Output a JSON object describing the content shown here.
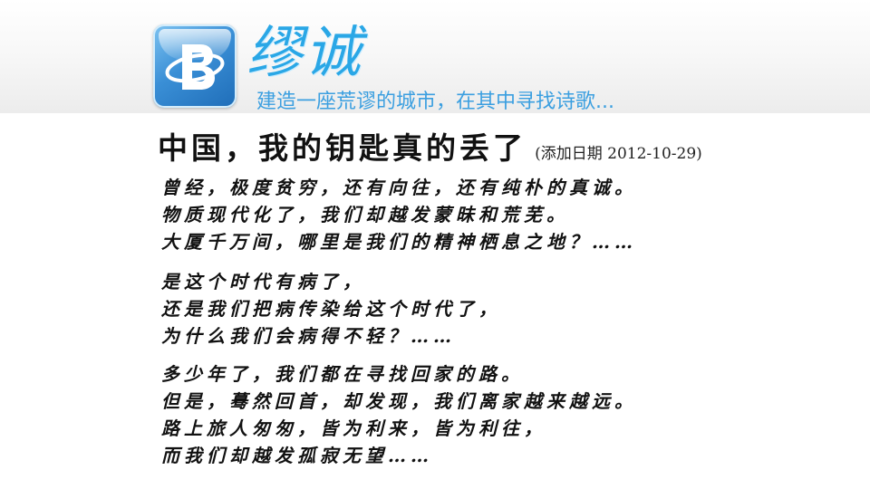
{
  "header": {
    "site_name": "缪诚",
    "tagline": "建造一座荒谬的城市，在其中寻找诗歌..."
  },
  "article": {
    "title": "中国，我的钥匙真的丢了",
    "date_note": "(添加日期 2012-10-29)",
    "stanzas": [
      {
        "lines": [
          "曾经，极度贫穷，还有向往，还有纯朴的真诚。",
          "物质现代化了，我们却越发蒙昧和荒芜。",
          "大厦千万间，哪里是我们的精神栖息之地？……"
        ]
      },
      {
        "lines": [
          "是这个时代有病了，",
          "还是我们把病传染给这个时代了，",
          "为什么我们会病得不轻？……"
        ]
      },
      {
        "lines": [
          "多少年了，我们都在寻找回家的路。",
          "但是，蓦然回首，却发现，我们离家越来越远。",
          "路上旅人匆匆，皆为利来，皆为利往，",
          "而我们却越发孤寂无望……"
        ]
      }
    ]
  },
  "colors": {
    "brand_blue": "#2aa7e6",
    "tagline_blue": "#3b9fe0",
    "text": "#111111"
  }
}
